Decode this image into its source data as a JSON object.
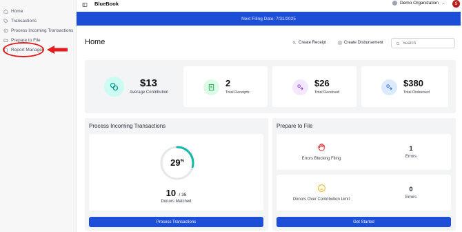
{
  "sidebar": {
    "items": [
      {
        "label": "Home",
        "icon": "home-icon"
      },
      {
        "label": "Transactions",
        "icon": "tag-icon"
      },
      {
        "label": "Process Incoming Transactions",
        "icon": "dollar-circle-icon"
      },
      {
        "label": "Prepare to File",
        "icon": "folder-icon"
      },
      {
        "label": "Report Manager",
        "icon": "document-icon"
      }
    ]
  },
  "topbar": {
    "brand": "BlueBook",
    "org": "Demo Organization",
    "avatar": "S"
  },
  "banner": {
    "text": "Next Filing Date: 7/31/2025"
  },
  "header": {
    "title": "Home",
    "create_receipt": "Create Receipt",
    "create_disbursement": "Create Disbursement",
    "search_placeholder": "Search"
  },
  "stats": [
    {
      "value": "$13",
      "label": "Average Contribution",
      "color": "#14b8a6"
    },
    {
      "value": "2",
      "label": "Total Receipts",
      "color": "#16a34a"
    },
    {
      "value": "$26",
      "label": "Total Received",
      "color": "#9333ea"
    },
    {
      "value": "$380",
      "label": "Total Disbursed",
      "color": "#2563eb"
    }
  ],
  "process": {
    "title": "Process Incoming Transactions",
    "percent": "29",
    "percent_sign": "%",
    "matched": "10",
    "total": "/ 35",
    "matched_label": "Donors Matched",
    "button": "Process Transactions",
    "progress_fraction": 0.29
  },
  "prepare": {
    "title": "Prepare to File",
    "blocking_label": "Errors Blocking Filing",
    "blocking_count": "1",
    "blocking_unit": "Errors",
    "limit_label": "Donors Over Contribution Limit",
    "limit_count": "0",
    "limit_unit": "Errors",
    "button": "Get Started"
  },
  "colors": {
    "accent": "#1d4ed8",
    "annotation": "#e11d1d"
  }
}
